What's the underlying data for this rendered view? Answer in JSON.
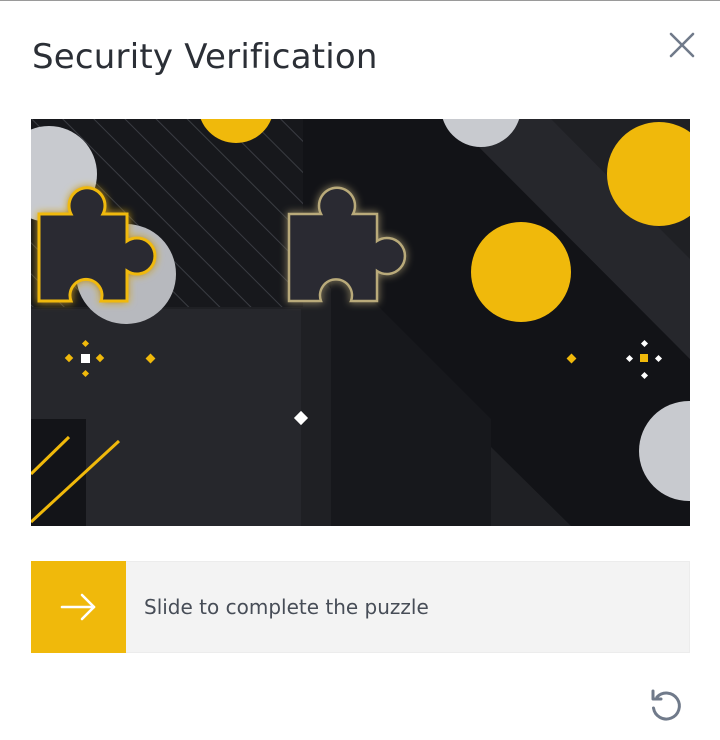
{
  "dialog": {
    "title": "Security Verification",
    "close_icon": "close-icon",
    "refresh_icon": "refresh-icon"
  },
  "puzzle": {
    "background_icon": "puzzle-background-image",
    "piece_icon": "puzzle-piece",
    "slot_icon": "puzzle-slot"
  },
  "slider": {
    "label": "Slide to complete the puzzle",
    "handle_icon": "arrow-right-icon"
  },
  "colors": {
    "accent": "#f0b90b",
    "text": "#2b2f36",
    "slider_track": "#f3f3f3",
    "puzzle_bg": "#1b1c20"
  }
}
